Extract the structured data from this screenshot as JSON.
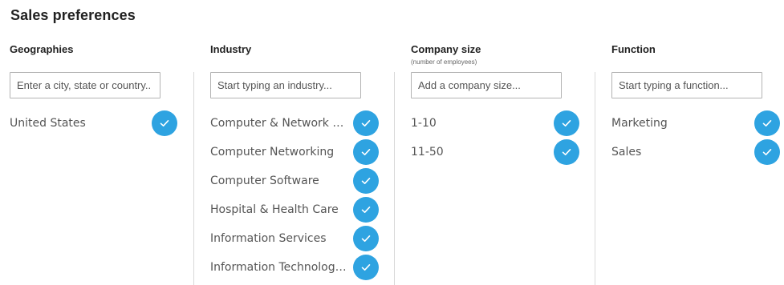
{
  "page_title": "Sales preferences",
  "accent_color": "#2ea3e1",
  "columns": {
    "geographies": {
      "header": "Geographies",
      "placeholder": "Enter a city, state or country..",
      "items": [
        {
          "label": "United States",
          "selected": true
        }
      ]
    },
    "industry": {
      "header": "Industry",
      "placeholder": "Start typing an industry...",
      "items": [
        {
          "label": "Computer & Network Security",
          "selected": true
        },
        {
          "label": "Computer Networking",
          "selected": true
        },
        {
          "label": "Computer Software",
          "selected": true
        },
        {
          "label": "Hospital & Health Care",
          "selected": true
        },
        {
          "label": "Information Services",
          "selected": true
        },
        {
          "label": "Information Technology and Services",
          "selected": true
        }
      ]
    },
    "company_size": {
      "header": "Company size",
      "subheader": "(number of employees)",
      "placeholder": "Add a company size...",
      "items": [
        {
          "label": "1-10",
          "selected": true
        },
        {
          "label": "11-50",
          "selected": true
        }
      ]
    },
    "function": {
      "header": "Function",
      "placeholder": "Start typing a function...",
      "items": [
        {
          "label": "Marketing",
          "selected": true
        },
        {
          "label": "Sales",
          "selected": true
        }
      ]
    }
  },
  "icons": {
    "selected_item": "checkmark-icon"
  }
}
